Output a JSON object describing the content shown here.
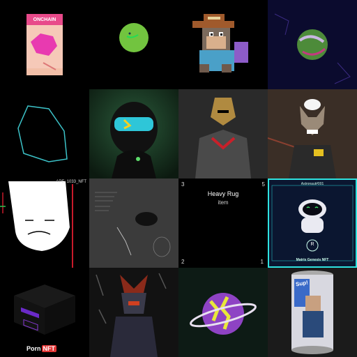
{
  "tiles": [
    {
      "name": "onchain-banana",
      "label": "ONCHAIN"
    },
    {
      "name": "green-ball"
    },
    {
      "name": "pixel-monkey"
    },
    {
      "name": "space-planet"
    },
    {
      "name": "outline-blob"
    },
    {
      "name": "masked-figure"
    },
    {
      "name": "armored-knight"
    },
    {
      "name": "wolf-character"
    },
    {
      "name": "upside-down-wojak",
      "label": "APE: 1033_NFT"
    },
    {
      "name": "sketch-scene"
    },
    {
      "name": "heavy-rug",
      "title": "Heavy Rug",
      "subtitle": "item",
      "corner_top_left": "3",
      "corner_top_right": "5",
      "corner_bottom_left": "2",
      "corner_bottom_right": "1"
    },
    {
      "name": "astronaut-card",
      "header": "Astronaut#001",
      "badge": "R",
      "footer": "Matrix Genesis NFT"
    },
    {
      "name": "porn-nft-box",
      "logo_text": "Porn",
      "logo_box": "NFT"
    },
    {
      "name": "samurai-armor"
    },
    {
      "name": "ringed-planet"
    },
    {
      "name": "figure-can",
      "label": "Sup!"
    }
  ]
}
